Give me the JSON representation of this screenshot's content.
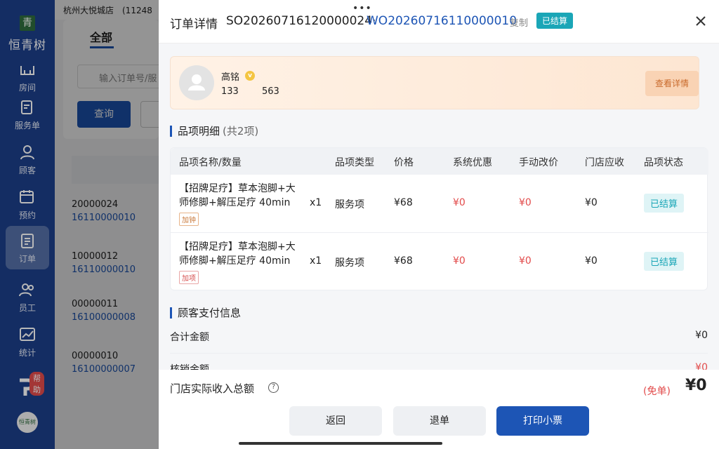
{
  "sidebar": {
    "logo_mark": "青",
    "logo_text": "恒青树",
    "items": [
      {
        "label": "房间"
      },
      {
        "label": "服务单"
      },
      {
        "label": "顾客"
      },
      {
        "label": "预约"
      },
      {
        "label": "订单"
      },
      {
        "label": "员工"
      },
      {
        "label": "统计"
      }
    ],
    "help_label": "帮助",
    "bottom_avatar": "恒青树"
  },
  "background": {
    "store": "杭州大悦城店　(11248",
    "tab_all": "全部",
    "search_placeholder": "输入订单号/服",
    "query_label": "查询",
    "rows": [
      {
        "a": "20000024",
        "b": "16110000010"
      },
      {
        "a": "10000012",
        "b": "16110000010"
      },
      {
        "a": "00000011",
        "b": "16100000008"
      },
      {
        "a": "00000010",
        "b": "16100000007"
      }
    ]
  },
  "modal": {
    "title": "订单详情",
    "so_number": "SO20260716120000024·",
    "wo_number": "WO20260716110000010",
    "copy_label": "复制",
    "status": "已结算",
    "customer": {
      "name": "高铭",
      "vip_mark": "v",
      "phone_prefix": "133",
      "phone_suffix": "563",
      "view_detail": "查看详情"
    },
    "items_section": {
      "title": "品项明细",
      "count": "(共2项)",
      "headers": [
        "品项名称/数量",
        "品项类型",
        "价格",
        "系统优惠",
        "手动改价",
        "门店应收",
        "品项状态"
      ],
      "rows": [
        {
          "name": "【招牌足疗】草本泡脚+大师修脚+解压足疗 40min",
          "tag": "加钟",
          "qty": "x1",
          "type": "服务项",
          "price": "¥68",
          "discount": "¥0",
          "manual": "¥0",
          "receivable": "¥0",
          "status": "已结算"
        },
        {
          "name": "【招牌足疗】草本泡脚+大师修脚+解压足疗 40min",
          "tag": "加项",
          "qty": "x1",
          "type": "服务项",
          "price": "¥68",
          "discount": "¥0",
          "manual": "¥0",
          "receivable": "¥0",
          "status": "已结算"
        }
      ]
    },
    "payment_section": {
      "title": "顾客支付信息",
      "rows": [
        {
          "label": "合计金额",
          "value": "¥0"
        },
        {
          "label": "核销金额",
          "value": "¥0"
        }
      ]
    },
    "footer": {
      "total_label": "门店实际收入总额",
      "help_mark": "?",
      "free_tag": "(免单)",
      "total_value": "¥0",
      "back_label": "返回",
      "refund_label": "退单",
      "print_label": "打印小票"
    }
  }
}
